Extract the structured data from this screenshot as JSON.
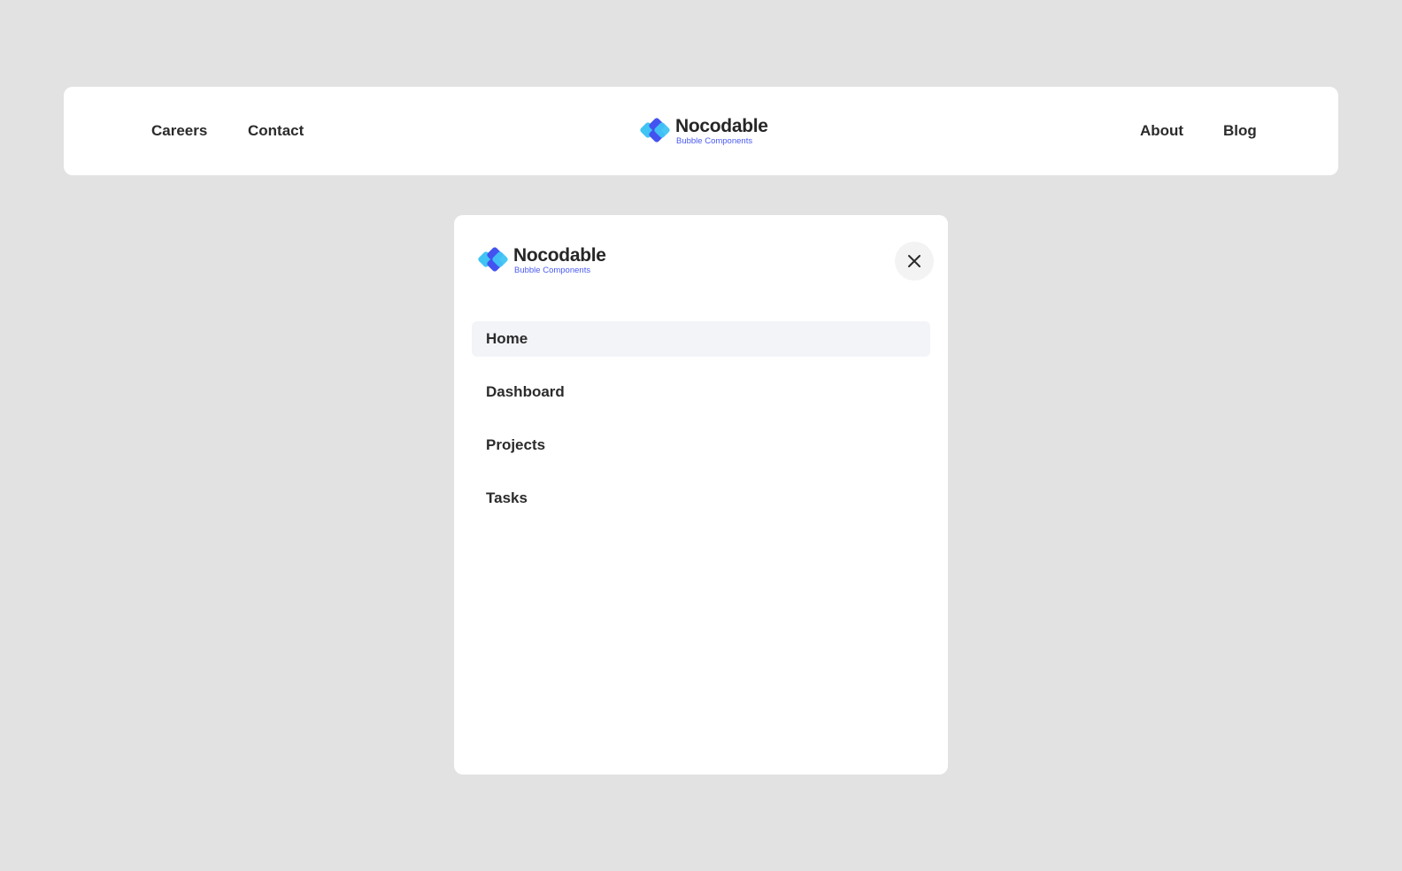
{
  "brand": {
    "name": "Nocodable",
    "tagline": "Bubble Components",
    "logo_icon": "nocodable-logo-icon",
    "colors": {
      "dark_blue": "#4353f0",
      "light_blue": "#40c4f4",
      "tagline": "#4a5bf0"
    }
  },
  "navbar": {
    "left_links": [
      {
        "label": "Careers"
      },
      {
        "label": "Contact"
      }
    ],
    "right_links": [
      {
        "label": "About"
      },
      {
        "label": "Blog"
      }
    ]
  },
  "mobile_menu": {
    "close_icon": "close-icon",
    "items": [
      {
        "label": "Home",
        "active": true
      },
      {
        "label": "Dashboard",
        "active": false
      },
      {
        "label": "Projects",
        "active": false
      },
      {
        "label": "Tasks",
        "active": false
      }
    ],
    "active_bg": "#f3f4f8"
  }
}
